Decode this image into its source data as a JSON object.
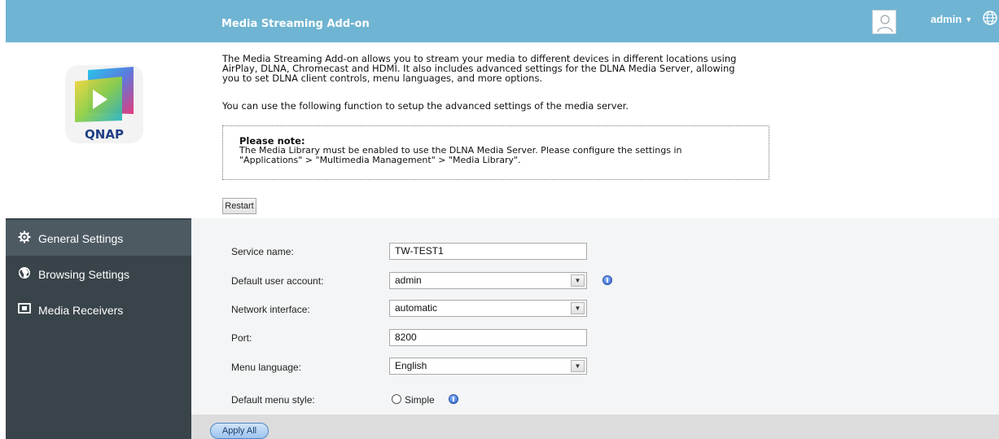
{
  "header": {
    "title": "Media Streaming Add-on",
    "user": "admin",
    "user_caret": "▼"
  },
  "logo": {
    "text": "QNAP"
  },
  "description": {
    "line1": "The Media Streaming Add-on allows you to stream your media to different devices in different locations using",
    "line2": "AirPlay, DLNA, Chromecast and HDMI. It also includes advanced settings for the DLNA Media Server, allowing",
    "line3": "you to set DLNA client controls, menu languages, and more options.",
    "line4": "You can use the following function to setup the advanced settings of the media server."
  },
  "note": {
    "title": "Please note:",
    "line1": "The Media Library must be enabled to use the DLNA Media Server. Please configure the settings in",
    "line2": "\"Applications\" > \"Multimedia Management\" > \"Media Library\"."
  },
  "restart_label": "Restart",
  "sidebar": {
    "items": [
      {
        "label": "General Settings",
        "icon": "gear-icon",
        "active": true
      },
      {
        "label": "Browsing Settings",
        "icon": "globe-icon",
        "active": false
      },
      {
        "label": "Media Receivers",
        "icon": "monitor-icon",
        "active": false
      }
    ]
  },
  "form": {
    "service_name": {
      "label": "Service name:",
      "value": "TW-TEST1"
    },
    "default_user": {
      "label": "Default user account:",
      "value": "admin"
    },
    "network_interface": {
      "label": "Network interface:",
      "value": "automatic"
    },
    "port": {
      "label": "Port:",
      "value": "8200"
    },
    "menu_language": {
      "label": "Menu language:",
      "value": "English"
    },
    "menu_style": {
      "label": "Default menu style:",
      "option": "Simple"
    }
  },
  "apply_label": "Apply All",
  "colors": {
    "header": "#6fb4d2",
    "sidebar": "#39444a",
    "sidebar_active": "#4d5a62",
    "content_bg": "#f4f5f6"
  }
}
